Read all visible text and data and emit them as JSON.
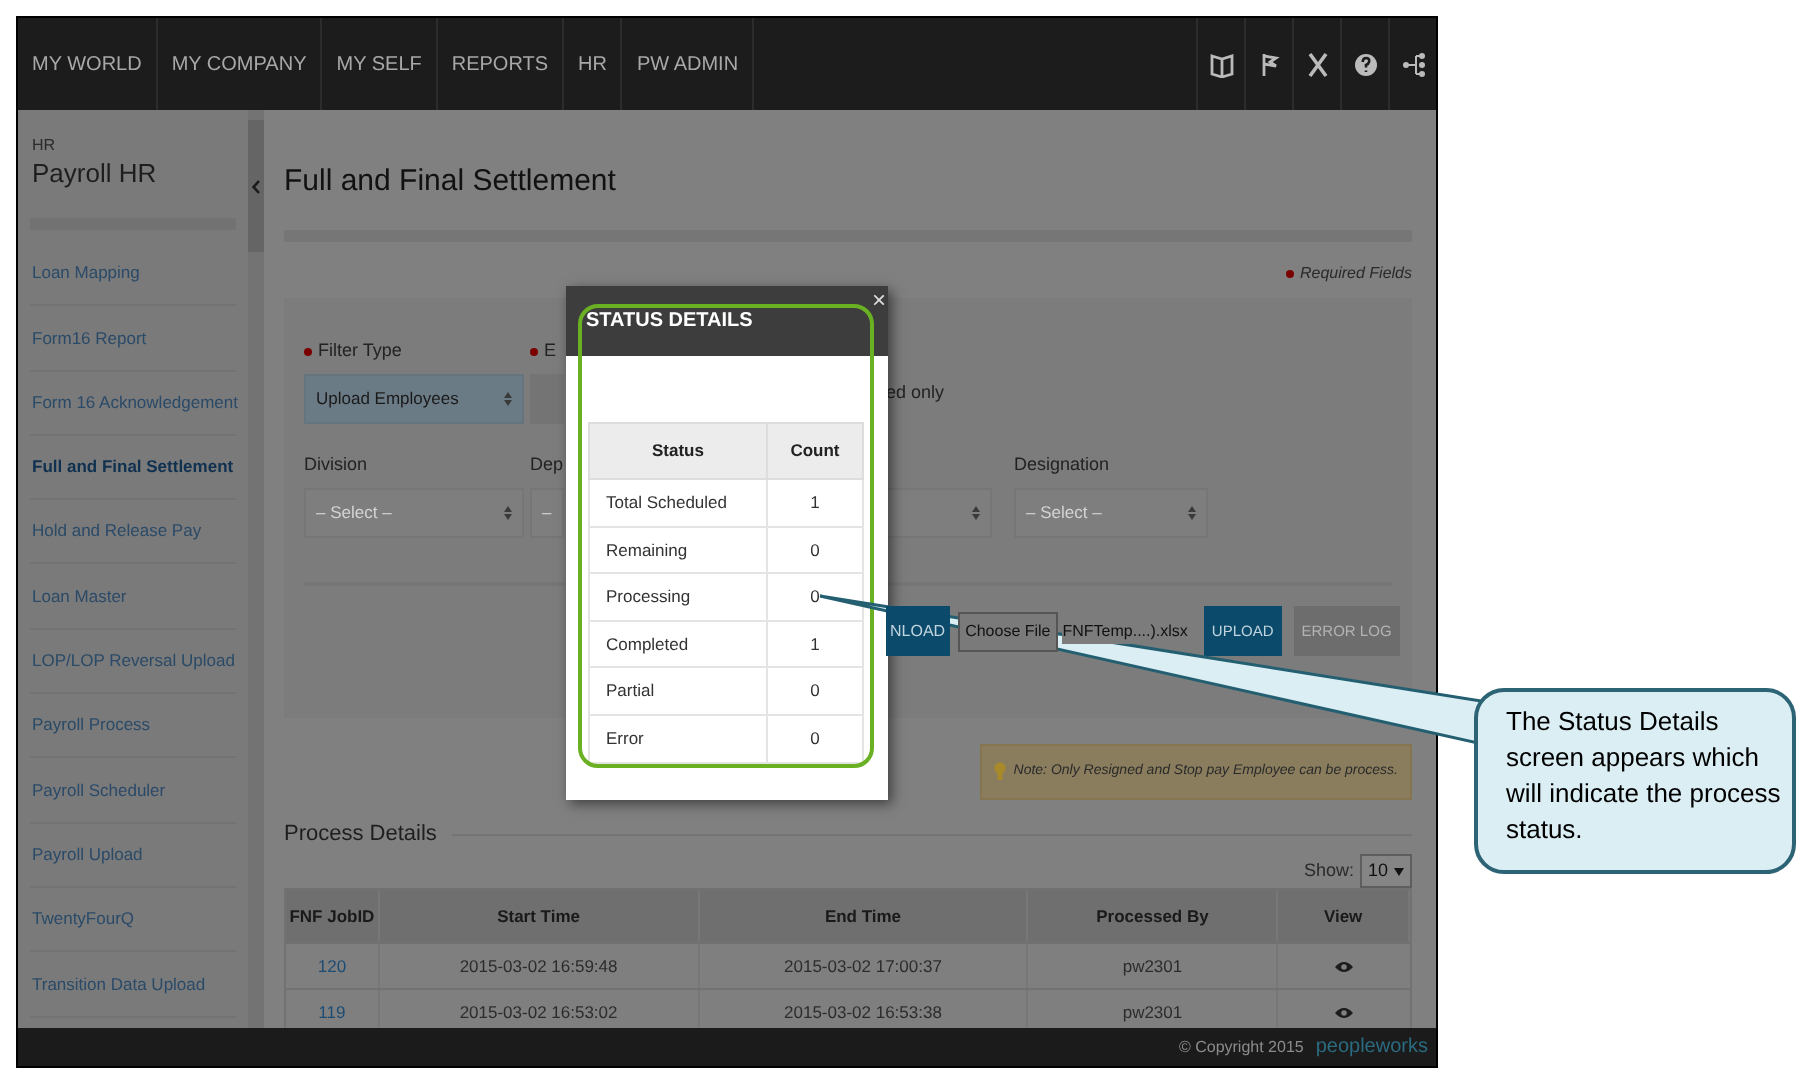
{
  "nav": {
    "items": [
      "MY WORLD",
      "MY COMPANY",
      "MY SELF",
      "REPORTS",
      "HR",
      "PW ADMIN"
    ]
  },
  "sidebar": {
    "section": "HR",
    "title": "Payroll HR",
    "items": [
      {
        "label": "Loan Mapping",
        "selected": false
      },
      {
        "label": "Form16 Report",
        "selected": false
      },
      {
        "label": "Form 16 Acknowledgement",
        "selected": false
      },
      {
        "label": "Full and Final Settlement",
        "selected": true
      },
      {
        "label": "Hold and Release Pay",
        "selected": false
      },
      {
        "label": "Loan Master",
        "selected": false
      },
      {
        "label": "LOP/LOP Reversal Upload",
        "selected": false
      },
      {
        "label": "Payroll Process",
        "selected": false
      },
      {
        "label": "Payroll Scheduler",
        "selected": false
      },
      {
        "label": "Payroll Upload",
        "selected": false
      },
      {
        "label": "TwentyFourQ",
        "selected": false
      },
      {
        "label": "Transition Data Upload",
        "selected": false
      }
    ]
  },
  "page": {
    "title": "Full and Final Settlement",
    "required_note": "Required Fields",
    "form": {
      "filter_type": {
        "label": "Filter Type",
        "required": true,
        "value": "Upload Employees"
      },
      "field_2": {
        "label": "E",
        "required": true
      },
      "field_2_note": "ed only",
      "division": {
        "label": "Division",
        "placeholder": "– Select –"
      },
      "field_4": {
        "label": "Dep",
        "placeholder": "–"
      },
      "designation": {
        "label": "Designation",
        "placeholder": "– Select –"
      },
      "upload_row": {
        "download_button": "NLOAD",
        "file_button": "Choose File",
        "file_name": "FNFTemp....).xlsx",
        "buttons": [
          {
            "label": "UPLOAD",
            "disabled": false
          },
          {
            "label": "ERROR LOG",
            "disabled": true
          }
        ]
      }
    },
    "note": "Note: Only Resigned and Stop pay Employee can be process.",
    "process_details": {
      "title": "Process Details",
      "show_label": "Show:",
      "page_size": "10",
      "columns": [
        "FNF JobID",
        "Start Time",
        "End Time",
        "Processed By",
        "View"
      ],
      "rows": [
        {
          "job_id": "120",
          "start_time": "2015-03-02 16:59:48",
          "end_time": "2015-03-02 17:00:37",
          "processed_by": "pw2301"
        },
        {
          "job_id": "119",
          "start_time": "2015-03-02 16:53:02",
          "end_time": "2015-03-02 16:53:38",
          "processed_by": "pw2301"
        }
      ]
    }
  },
  "modal": {
    "title": "STATUS DETAILS",
    "close": "×",
    "columns": [
      "Status",
      "Count"
    ],
    "rows": [
      {
        "status": "Total Scheduled",
        "count": "1"
      },
      {
        "status": "Remaining",
        "count": "0"
      },
      {
        "status": "Processing",
        "count": "0"
      },
      {
        "status": "Completed",
        "count": "1"
      },
      {
        "status": "Partial",
        "count": "0"
      },
      {
        "status": "Error",
        "count": "0"
      }
    ]
  },
  "footer": {
    "copyright": "© Copyright 2015",
    "logo": "peopleworks"
  },
  "callout": {
    "text": "The Status Details screen appears which will indicate the process status."
  }
}
